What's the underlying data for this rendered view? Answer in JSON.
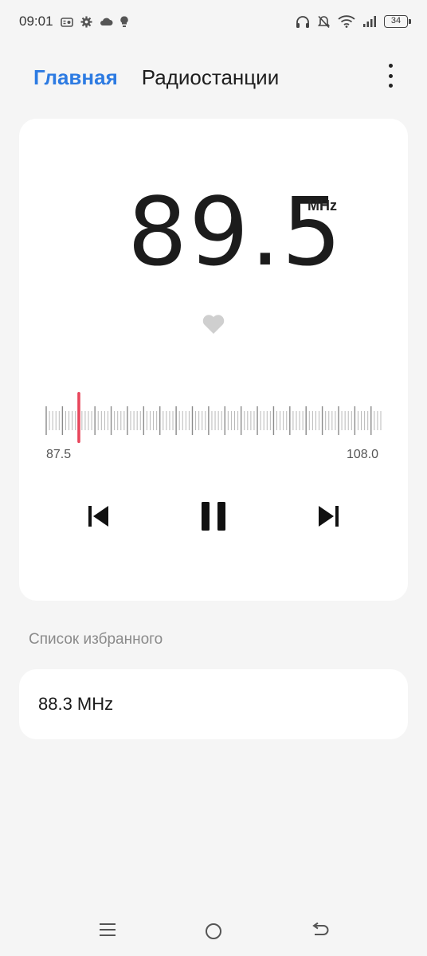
{
  "status": {
    "time": "09:01",
    "battery": "34",
    "left_icons": [
      "radio-app-icon",
      "gear-icon",
      "cloud-icon",
      "bulb-icon"
    ],
    "right_icons": [
      "headphones-icon",
      "bell-off-icon",
      "wifi-icon",
      "signal-icon",
      "battery-icon"
    ]
  },
  "nav": {
    "tabs": [
      {
        "label": "Главная",
        "active": true
      },
      {
        "label": "Радиостанции",
        "active": false
      }
    ],
    "more_icon": "more-vertical-icon"
  },
  "player": {
    "frequency": "89.5",
    "unit": "MHz",
    "favorite_icon": "heart-icon",
    "scale_min": "87.5",
    "scale_max": "108.0",
    "tuned_value": 89.5,
    "range": [
      87.5,
      108.0
    ],
    "controls": [
      "skip-previous-icon",
      "pause-icon",
      "skip-next-icon"
    ],
    "accent_color": "#e8465c"
  },
  "favorites": {
    "title": "Список избранного",
    "items": [
      {
        "label": "88.3 MHz"
      }
    ]
  },
  "system_nav": [
    "menu-icon",
    "home-icon",
    "back-icon"
  ],
  "colors": {
    "accent": "#2d7be2",
    "background": "#f5f5f5",
    "card": "#ffffff"
  }
}
